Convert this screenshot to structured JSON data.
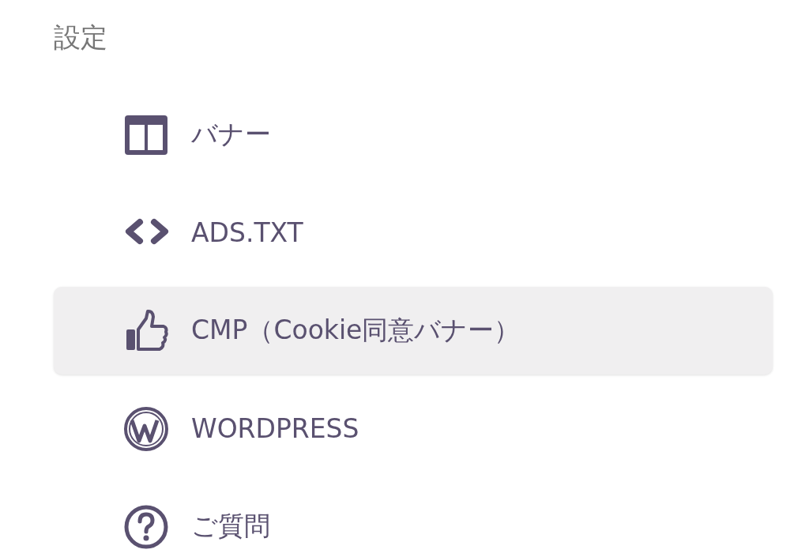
{
  "heading": "設定",
  "menu": [
    {
      "label": "バナー",
      "kind": "layout",
      "selected": false
    },
    {
      "label": "ADS.TXT",
      "kind": "code",
      "selected": false
    },
    {
      "label": "CMP（Cookie同意バナー）",
      "kind": "thumb",
      "selected": true
    },
    {
      "label": "WORDPRESS",
      "kind": "wp",
      "selected": false
    },
    {
      "label": "ご質問",
      "kind": "help",
      "selected": false
    }
  ]
}
